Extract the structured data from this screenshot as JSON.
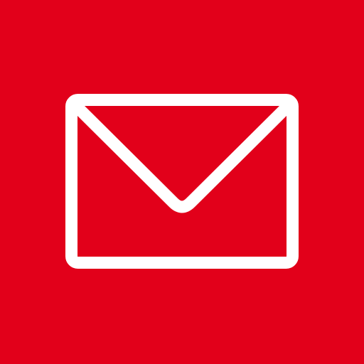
{
  "app_icon": {
    "name": "mail-app-icon",
    "icon": "envelope-icon",
    "colors": {
      "background": "#e2001a",
      "glyph": "#ffffff"
    }
  }
}
